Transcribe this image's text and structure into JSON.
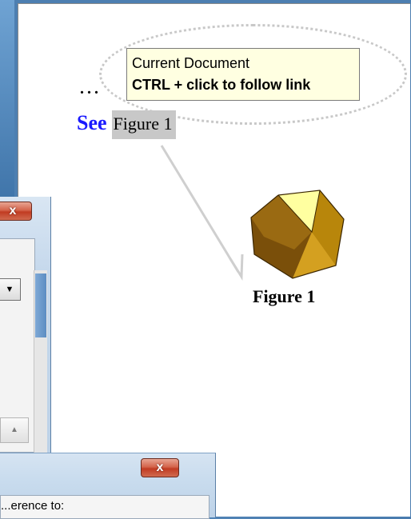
{
  "tooltip": {
    "line1": "Current Document",
    "line2": "CTRL + click to follow link"
  },
  "document": {
    "ellipses": "...",
    "see_word": "See",
    "link_text": "Figure 1",
    "figure_caption": "Figure 1"
  },
  "dialogs": {
    "dialog1": {
      "close_label": "x"
    },
    "dialog2": {
      "close_label": "x",
      "partial_text": "...erence to:"
    }
  },
  "colors": {
    "see_word": "#1a1aff",
    "tooltip_bg": "#ffffe1",
    "link_highlight": "#c8c8c8",
    "close_button": "#c13b22"
  },
  "icons": {
    "figure": "dodecahedron-icon",
    "arrow": "link-arrow",
    "dropdown": "chevron-down-icon",
    "scroll_up": "chevron-up-icon"
  }
}
